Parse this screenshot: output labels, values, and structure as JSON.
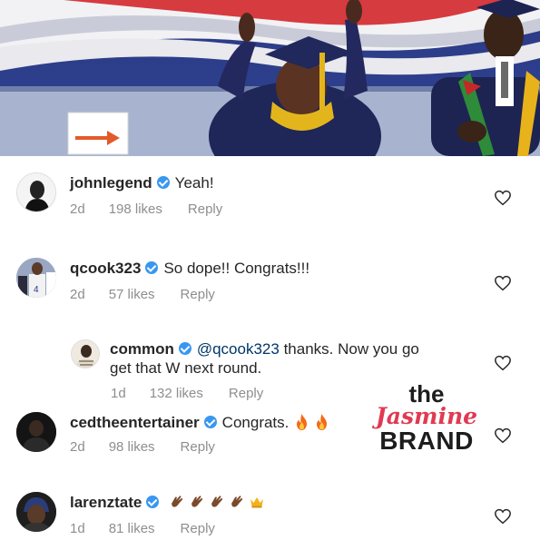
{
  "comments": [
    {
      "username": "johnlegend",
      "text": "Yeah!",
      "time": "2d",
      "likes": "198 likes",
      "reply": "Reply"
    },
    {
      "username": "qcook323",
      "text": "So dope!! Congrats!!!",
      "time": "2d",
      "likes": "57 likes",
      "reply": "Reply"
    },
    {
      "username": "common",
      "mention": "@qcook323",
      "text_line1": "thanks.  Now you go",
      "text_line2": "get that W next round.",
      "time": "1d",
      "likes": "132 likes",
      "reply": "Reply"
    },
    {
      "username": "cedtheentertainer",
      "text": "Congrats.",
      "time": "2d",
      "likes": "98 likes",
      "reply": "Reply"
    },
    {
      "username": "larenztate",
      "text": "",
      "time": "1d",
      "likes": "81 likes",
      "reply": "Reply"
    }
  ],
  "watermark": {
    "the": "the",
    "jasmine": "Jasmine",
    "brand": "BRAND"
  },
  "icons": {
    "verified": "verified-badge-icon",
    "like": "heart-outline-icon",
    "fire": "fire-emoji",
    "clap": "clap-emoji",
    "crown": "crown-emoji"
  },
  "colors": {
    "verified": "#3897f0",
    "meta": "#8e8e8e",
    "mention": "#003569",
    "watermark_accent": "#e03a52"
  }
}
